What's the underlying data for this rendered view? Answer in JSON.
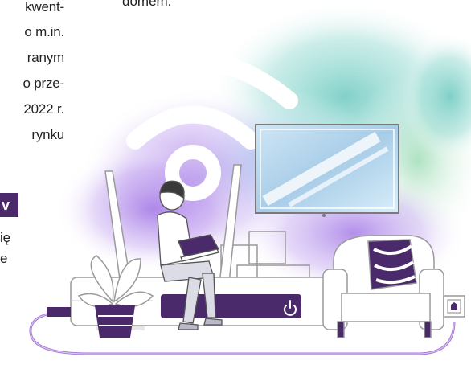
{
  "article": {
    "top_fragment": "domem.",
    "left_lines": [
      "kwent-",
      "o m.in.",
      "ranym",
      "o prze-",
      "2022 r.",
      "rynku"
    ],
    "highlight_tag": "v",
    "lower_lines": [
      "ię",
      "e"
    ]
  },
  "illustration": {
    "router_power_icon": "power-icon",
    "wall_socket_icon": "ethernet-port-icon",
    "colors": {
      "purple": "#4b2a6b",
      "outline": "#9a9a9a",
      "cable": "#a87ad6",
      "teal_wash": "#7fd3c6",
      "violet_wash": "#b48ee8"
    }
  }
}
